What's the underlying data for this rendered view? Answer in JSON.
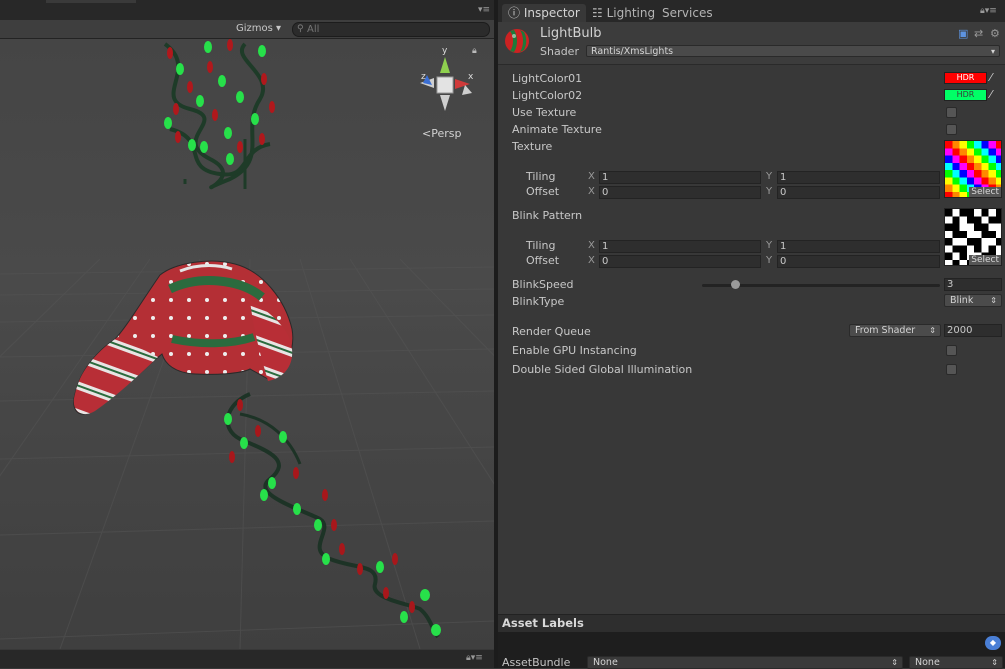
{
  "scene": {
    "gizmos_label": "Gizmos ▾",
    "search_placeholder": "All",
    "persp_label": "Persp",
    "gizmo_axes": {
      "y": "y",
      "x": "x",
      "z": "z"
    }
  },
  "inspector": {
    "tabs": [
      {
        "label": "Inspector",
        "icon": "info-icon",
        "active": true
      },
      {
        "label": "Lighting",
        "icon": "lighting-icon",
        "active": false
      },
      {
        "label": "Services",
        "icon": "",
        "active": false
      }
    ],
    "material": {
      "name": "LightBulb",
      "shader_label": "Shader",
      "shader_value": "Rantis/XmsLights"
    },
    "properties": {
      "light_color_01": {
        "label": "LightColor01",
        "color": "#ff0000",
        "badge": "HDR"
      },
      "light_color_02": {
        "label": "LightColor02",
        "color": "#00ff66",
        "badge": "HDR"
      },
      "use_texture": {
        "label": "Use Texture",
        "checked": false
      },
      "animate_texture": {
        "label": "Animate Texture",
        "checked": false
      },
      "texture": {
        "label": "Texture",
        "tiling_label": "Tiling",
        "offset_label": "Offset",
        "x_label": "X",
        "y_label": "Y",
        "tiling_x": "1",
        "tiling_y": "1",
        "offset_x": "0",
        "offset_y": "0",
        "select_label": "Select"
      },
      "blink_pattern": {
        "label": "Blink Pattern",
        "tiling_label": "Tiling",
        "offset_label": "Offset",
        "x_label": "X",
        "y_label": "Y",
        "tiling_x": "1",
        "tiling_y": "1",
        "offset_x": "0",
        "offset_y": "0",
        "select_label": "Select"
      },
      "blink_speed": {
        "label": "BlinkSpeed",
        "value": "3",
        "slider_fraction": 0.14
      },
      "blink_type": {
        "label": "BlinkType",
        "value": "Blink"
      },
      "render_queue": {
        "label": "Render Queue",
        "mode": "From Shader",
        "value": "2000"
      },
      "gpu_instancing": {
        "label": "Enable GPU Instancing",
        "checked": false
      },
      "double_sided_gi": {
        "label": "Double Sided Global Illumination",
        "checked": false
      }
    },
    "asset_labels": {
      "title": "Asset Labels",
      "bundle_label": "AssetBundle",
      "bundle_value": "None",
      "variant_value": "None"
    }
  }
}
